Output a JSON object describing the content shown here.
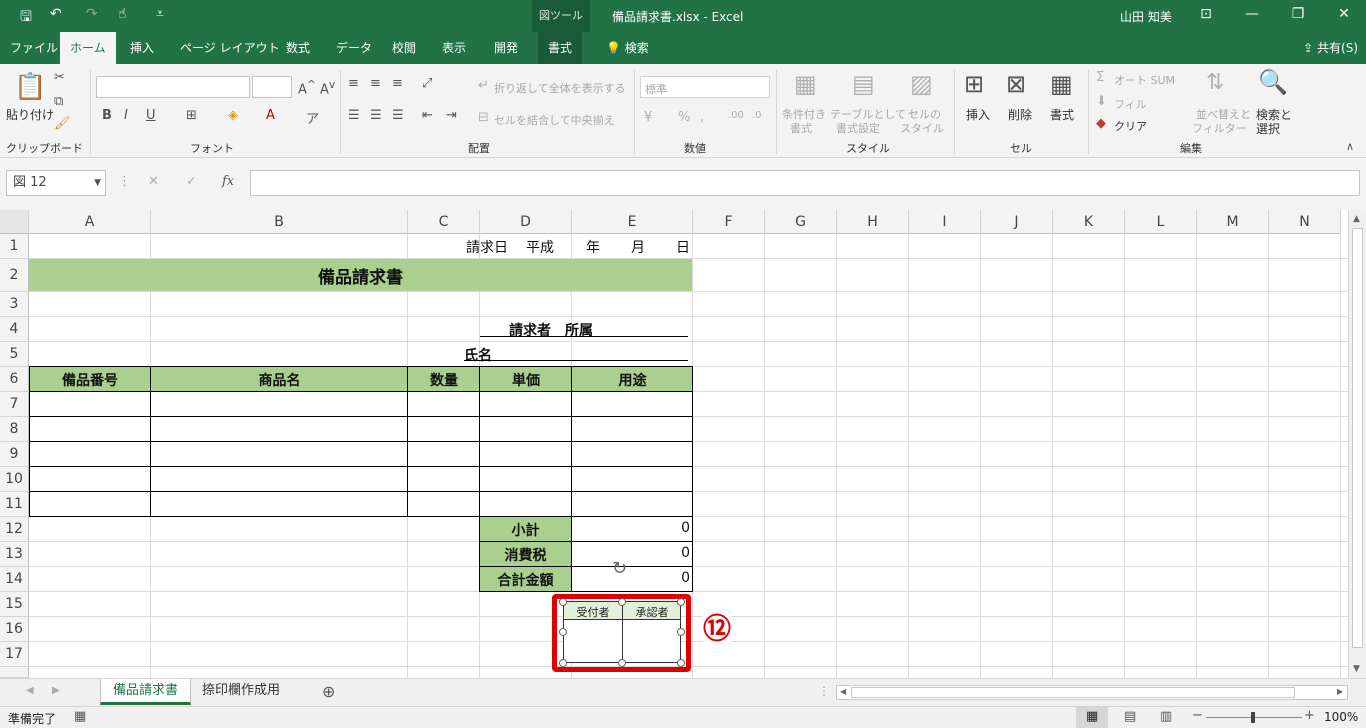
{
  "titlebar": {
    "tool_context": "図ツール",
    "doc_title": "備品請求書.xlsx  -  Excel",
    "user_name": "山田 知美",
    "icons": [
      "save-icon",
      "undo-icon",
      "redo-icon",
      "touch-mode-icon",
      "customize-icon"
    ]
  },
  "ribbon_tabs": [
    "ファイル",
    "ホーム",
    "挿入",
    "ページ レイアウト",
    "数式",
    "データ",
    "校閲",
    "表示",
    "開発",
    "書式",
    "検索"
  ],
  "share_label": "共有(S)",
  "ribbon": {
    "clipboard": {
      "paste": "貼り付け",
      "group": "クリップボード"
    },
    "font": {
      "group": "フォント",
      "bold": "B",
      "italic": "I",
      "underline": "U"
    },
    "alignment": {
      "group": "配置",
      "wrap": "折り返して全体を表示する",
      "merge": "セルを結合して中央揃え"
    },
    "number": {
      "group": "数値",
      "format": "標準"
    },
    "styles": {
      "group": "スタイル",
      "cond1": "条件付き",
      "cond2": "書式",
      "table1": "テーブルとして",
      "table2": "書式設定",
      "cell1": "セルの",
      "cell2": "スタイル"
    },
    "cells": {
      "group": "セル",
      "insert": "挿入",
      "delete": "削除",
      "format": "書式"
    },
    "editing": {
      "group": "編集",
      "autosum": "オート SUM",
      "fill": "フィル",
      "clear": "クリア",
      "sort1": "並べ替えと",
      "sort2": "フィルター",
      "find1": "検索と",
      "find2": "選択"
    }
  },
  "formula_bar": {
    "name_box": "図 12",
    "fx": "fx",
    "cancel": "✕",
    "enter": "✓",
    "formula": ""
  },
  "columns": [
    "A",
    "B",
    "C",
    "D",
    "E",
    "F",
    "G",
    "H",
    "I",
    "J",
    "K",
    "L",
    "M",
    "N"
  ],
  "rows": [
    "1",
    "2",
    "3",
    "4",
    "5",
    "6",
    "7",
    "8",
    "9",
    "10",
    "11",
    "12",
    "13",
    "14",
    "15",
    "16",
    "17"
  ],
  "sheet": {
    "date_line": {
      "label": "請求日",
      "era": "平成",
      "year": "年",
      "month": "月",
      "day": "日"
    },
    "title": "備品請求書",
    "requester": "請求者　所属",
    "name_label": "氏名",
    "headers": [
      "備品番号",
      "商品名",
      "数量",
      "単価",
      "用途"
    ],
    "summary": [
      {
        "label": "小計",
        "value": "0"
      },
      {
        "label": "消費税",
        "value": "0"
      },
      {
        "label": "合計金額",
        "value": "0"
      }
    ],
    "stamp_box": {
      "received": "受付者",
      "approved": "承認者"
    },
    "callout": "⑫"
  },
  "sheet_tabs": [
    "備品請求書",
    "捺印欄作成用"
  ],
  "status": {
    "ready": "準備完了",
    "zoom": "100%"
  },
  "colors": {
    "excel_green": "#217346",
    "header_fill": "#a9d08e",
    "callout_red": "#e00000"
  }
}
